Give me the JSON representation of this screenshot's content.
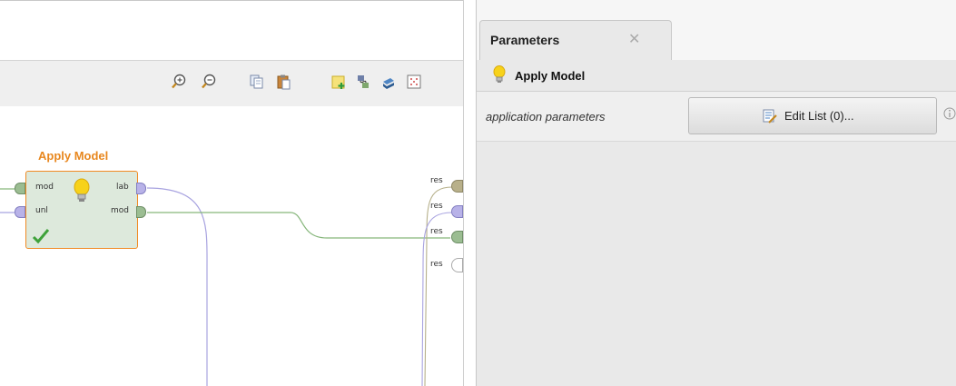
{
  "process": {
    "operator": {
      "title": "Apply Model",
      "inputs": [
        "mod",
        "unl"
      ],
      "outputs": [
        "lab",
        "mod"
      ],
      "status": "ok"
    },
    "result_ports": [
      "res",
      "res",
      "res",
      "res"
    ],
    "toolbar_icons": [
      "zoom-in-icon",
      "zoom-out-icon",
      "copy-icon",
      "paste-icon",
      "add-note-icon",
      "auto-wire-icon",
      "layers-icon",
      "fit-grid-icon"
    ]
  },
  "parameters": {
    "tab_label": "Parameters",
    "close_glyph": "✕",
    "header_title": "Apply Model",
    "rows": [
      {
        "name": "application parameters",
        "button_label": "Edit List (0)..."
      }
    ]
  },
  "colors": {
    "accent_orange": "#f08a24",
    "operator_fill": "#dde9dc",
    "port_green": "#9bbd92",
    "port_purple": "#b8b2e8",
    "wire_purple": "#a8a3e0",
    "wire_green": "#86b67b"
  }
}
